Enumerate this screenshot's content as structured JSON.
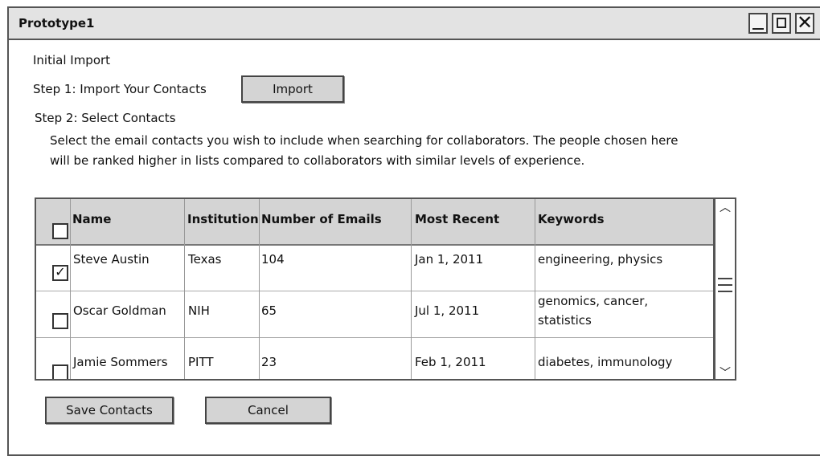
{
  "window": {
    "title": "Prototype1",
    "min_glyph": "",
    "max_glyph": "",
    "close_glyph": "✕"
  },
  "section": {
    "heading": "Initial Import",
    "step1": "Step 1: Import Your Contacts",
    "import_button": "Import",
    "step2": "Step 2: Select Contacts",
    "desc_line1": "Select the email contacts you wish to include when searching for collaborators.  The people chosen here",
    "desc_line2": "will be ranked higher in lists compared to collaborators with similar levels of experience."
  },
  "table": {
    "headers": [
      "Name",
      "Institution",
      "Number of Emails",
      "Most Recent",
      "Keywords"
    ],
    "rows": [
      {
        "checked": true,
        "check_mark": "✓",
        "name": "Steve Austin",
        "institution": "Texas",
        "emails": "104",
        "recent": "Jan 1, 2011",
        "keywords_l1": "engineering, physics",
        "keywords_l2": ""
      },
      {
        "checked": false,
        "check_mark": "",
        "name": "Oscar Goldman",
        "institution": "NIH",
        "emails": "65",
        "recent": "Jul 1, 2011",
        "keywords_l1": "genomics, cancer,",
        "keywords_l2": "statistics"
      },
      {
        "checked": false,
        "check_mark": "",
        "name": "Jamie Sommers",
        "institution": "PITT",
        "emails": "23",
        "recent": "Feb 1, 2011",
        "keywords_l1": "diabetes, immunology",
        "keywords_l2": ""
      }
    ]
  },
  "scrollbar": {
    "up_glyph": "︿",
    "down_glyph": "﹀"
  },
  "buttons": {
    "save": "Save Contacts",
    "cancel": "Cancel"
  }
}
